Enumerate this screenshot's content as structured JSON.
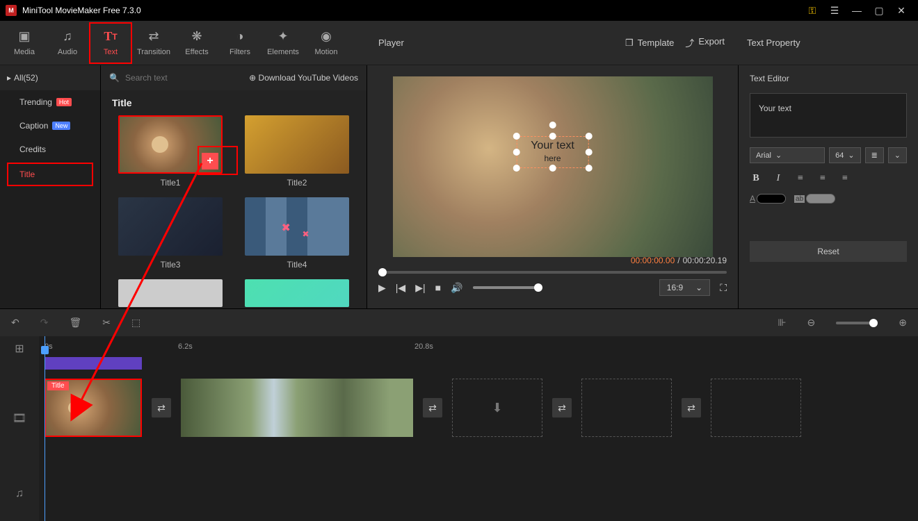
{
  "app": {
    "title": "MiniTool MovieMaker Free 7.3.0"
  },
  "toolbar": {
    "media": "Media",
    "audio": "Audio",
    "text": "Text",
    "transition": "Transition",
    "effects": "Effects",
    "filters": "Filters",
    "elements": "Elements",
    "motion": "Motion"
  },
  "sidebar": {
    "all": "All(52)",
    "items": [
      {
        "label": "Trending",
        "badge": "Hot"
      },
      {
        "label": "Caption",
        "badge": "New"
      },
      {
        "label": "Credits"
      },
      {
        "label": "Title"
      }
    ]
  },
  "gallery": {
    "search_placeholder": "Search text",
    "download": "Download YouTube Videos",
    "section": "Title",
    "items": [
      "Title1",
      "Title2",
      "Title3",
      "Title4"
    ]
  },
  "preview": {
    "label": "Player",
    "template": "Template",
    "export": "Export",
    "text_overlay": "Your text",
    "text_overlay2": "here",
    "time_current": "00:00:00.00",
    "time_total": "00:00:20.19",
    "ratio": "16:9"
  },
  "props": {
    "title": "Text Property",
    "editor_label": "Text Editor",
    "placeholder": "Your text",
    "font": "Arial",
    "size": "64",
    "reset": "Reset"
  },
  "timeline": {
    "marks": {
      "m0": "0s",
      "m1": "6.2s",
      "m2": "20.8s"
    },
    "clip_tag": "Title"
  }
}
